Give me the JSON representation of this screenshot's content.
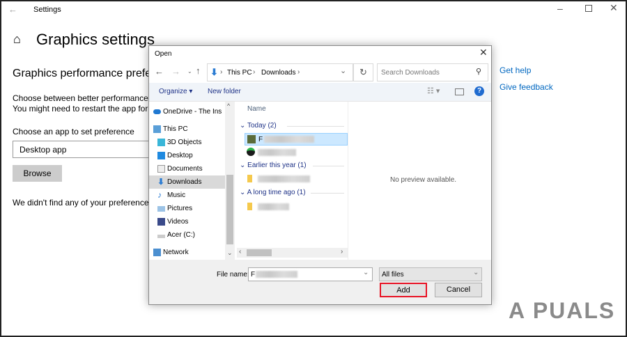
{
  "settings": {
    "window_title": "Settings",
    "page_title": "Graphics settings",
    "section_title": "Graphics performance prefe",
    "desc_line1": "Choose between better performance or",
    "desc_line2": "You might need to restart the app for yo",
    "choose_label": "Choose an app to set preference",
    "app_type_value": "Desktop app",
    "browse_label": "Browse",
    "empty_text": "We didn't find any of your preferences y",
    "get_help": "Get help",
    "give_feedback": "Give feedback"
  },
  "dialog": {
    "title": "Open",
    "breadcrumb": [
      "This PC",
      "Downloads"
    ],
    "search_placeholder": "Search Downloads",
    "organize": "Organize",
    "new_folder": "New folder",
    "nav_items": [
      {
        "label": "OneDrive - The Ins",
        "icon": "cloud-icon"
      },
      {
        "label": "This PC",
        "icon": "computer-icon"
      },
      {
        "label": "3D Objects",
        "icon": "cube-icon"
      },
      {
        "label": "Desktop",
        "icon": "desktop-icon"
      },
      {
        "label": "Documents",
        "icon": "document-icon"
      },
      {
        "label": "Downloads",
        "icon": "download-icon",
        "selected": true
      },
      {
        "label": "Music",
        "icon": "music-icon"
      },
      {
        "label": "Pictures",
        "icon": "picture-icon"
      },
      {
        "label": "Videos",
        "icon": "video-icon"
      },
      {
        "label": "Acer (C:)",
        "icon": "drive-icon"
      },
      {
        "label": "Network",
        "icon": "network-icon"
      }
    ],
    "column_name": "Name",
    "groups": [
      {
        "label": "Today (2)"
      },
      {
        "label": "Earlier this year (1)"
      },
      {
        "label": "A long time ago (1)"
      }
    ],
    "selected_file_prefix": "F",
    "preview_text": "No preview available.",
    "file_name_label": "File name:",
    "file_name_value": "F",
    "filter_value": "All files",
    "add_label": "Add",
    "cancel_label": "Cancel"
  },
  "watermark": "A PUALS",
  "colors": {
    "accent": "#0067c0",
    "highlight": "#e81123",
    "selection": "#cce8ff"
  }
}
